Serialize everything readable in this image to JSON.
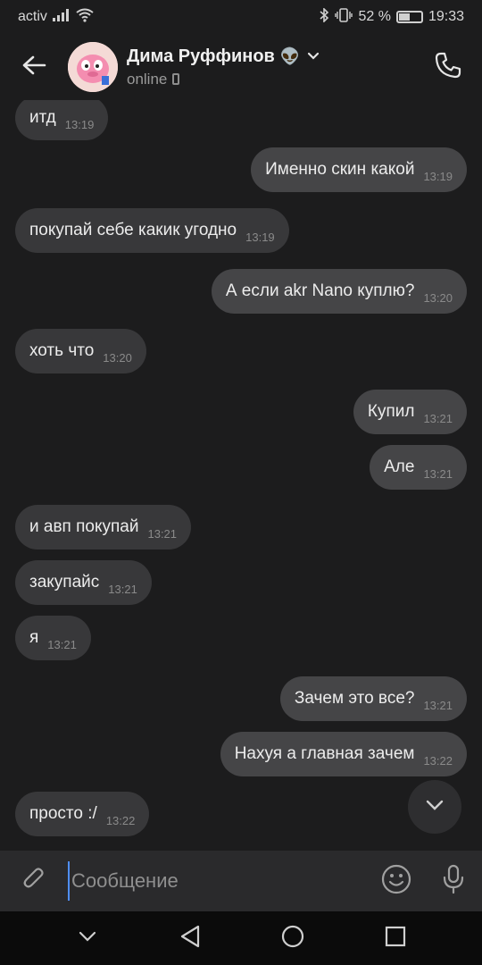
{
  "statusbar": {
    "carrier": "activ",
    "battery_pct": "52 %",
    "battery_level": 0.52,
    "time": "19:33"
  },
  "header": {
    "name": "Дима Руффинов",
    "name_emoji": "👽",
    "status": "online"
  },
  "messages": [
    {
      "dir": "in",
      "text": "итд",
      "time": "13:19"
    },
    {
      "dir": "out",
      "text": "Именно скин какой",
      "time": "13:19"
    },
    {
      "dir": "in",
      "text": "покупай себе какик угодно",
      "time": "13:19"
    },
    {
      "dir": "out",
      "text": "А если akr Nano куплю?",
      "time": "13:20"
    },
    {
      "dir": "in",
      "text": "хоть что",
      "time": "13:20"
    },
    {
      "dir": "out",
      "text": "Купил",
      "time": "13:21"
    },
    {
      "dir": "out",
      "text": "Але",
      "time": "13:21"
    },
    {
      "dir": "in",
      "text": "и авп покупай",
      "time": "13:21"
    },
    {
      "dir": "in",
      "text": "закупайс",
      "time": "13:21"
    },
    {
      "dir": "in",
      "text": "я",
      "time": "13:21"
    },
    {
      "dir": "out",
      "text": "Зачем это все?",
      "time": "13:21"
    },
    {
      "dir": "out",
      "text": "Нахуя а главная зачем",
      "time": "13:22"
    },
    {
      "dir": "in",
      "text": "просто :/",
      "time": "13:22"
    }
  ],
  "composer": {
    "placeholder": "Сообщение"
  },
  "colors": {
    "background": "#1c1c1d",
    "bubble_in": "#38383a",
    "bubble_out": "#454547",
    "accent": "#4f8ef7"
  },
  "icons": [
    "back-arrow-icon",
    "chevron-down-icon",
    "phone-call-icon",
    "scroll-down-icon",
    "paperclip-icon",
    "emoji-icon",
    "microphone-icon",
    "nav-back-icon",
    "nav-home-icon",
    "nav-recents-icon",
    "nav-hide-icon"
  ]
}
